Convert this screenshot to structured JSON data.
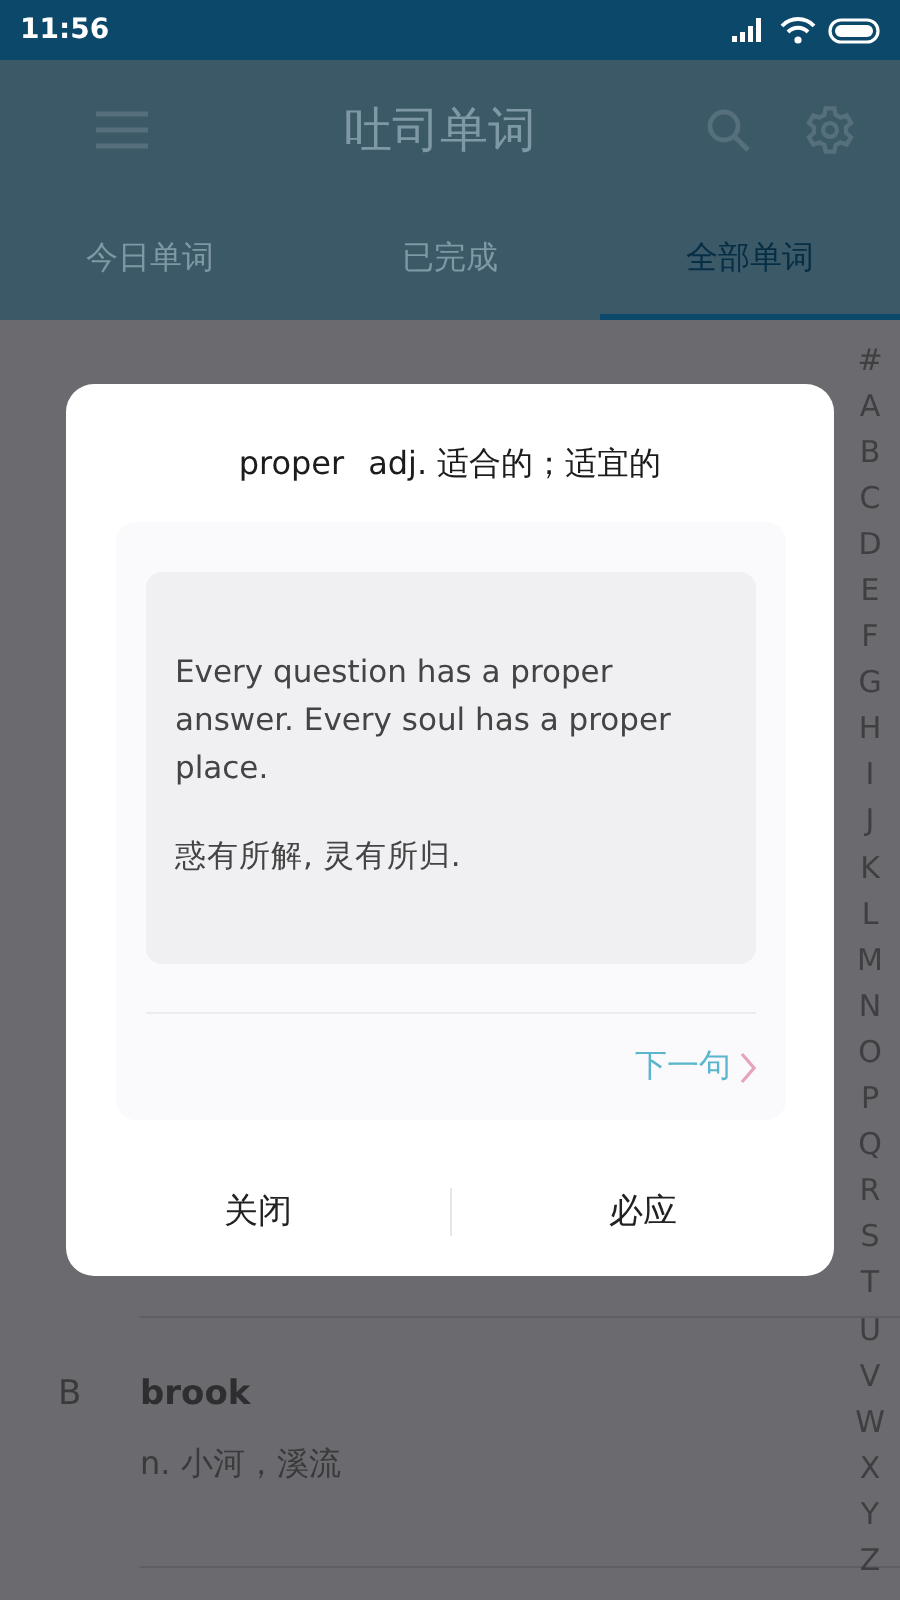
{
  "status_bar": {
    "time": "11:56"
  },
  "app_bar": {
    "title": "吐司单词"
  },
  "tabs": [
    {
      "label": "今日单词",
      "selected": false
    },
    {
      "label": "已完成",
      "selected": false
    },
    {
      "label": "全部单词",
      "selected": true
    }
  ],
  "word_list": [
    {
      "letter": "B",
      "word": "brook",
      "meaning": "n. 小河，溪流"
    }
  ],
  "index_bar": [
    "#",
    "A",
    "B",
    "C",
    "D",
    "E",
    "F",
    "G",
    "H",
    "I",
    "J",
    "K",
    "L",
    "M",
    "N",
    "O",
    "P",
    "Q",
    "R",
    "S",
    "T",
    "U",
    "V",
    "W",
    "X",
    "Y",
    "Z"
  ],
  "dialog": {
    "word": "proper",
    "definition": "adj. 适合的；适宜的",
    "sentence_en": "Every question has a proper answer. Every soul has a proper place.",
    "sentence_zh": "惑有所解, 灵有所归.",
    "next_label": "下一句",
    "buttons": [
      "关闭",
      "必应"
    ]
  }
}
